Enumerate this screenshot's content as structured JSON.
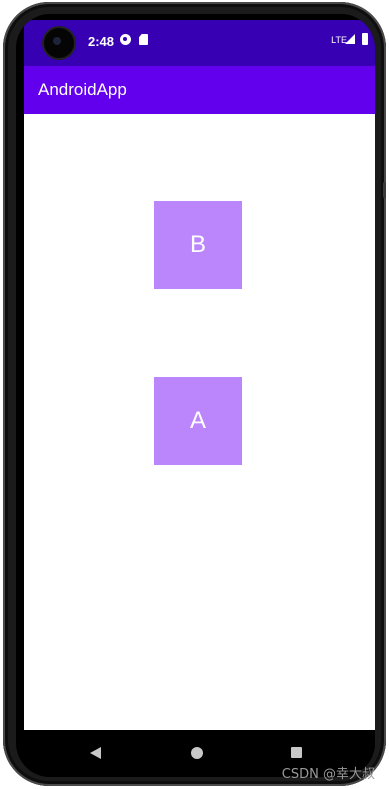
{
  "status_bar": {
    "time": "2:48",
    "network": "LTE",
    "background_color": "#3700b3",
    "icons": [
      "data-saver-icon",
      "sd-card-icon",
      "signal-icon",
      "battery-icon"
    ]
  },
  "app_bar": {
    "title": "AndroidApp",
    "background_color": "#6200ee"
  },
  "content": {
    "box_b_label": "B",
    "box_a_label": "A",
    "box_color": "#bb86fc"
  },
  "nav_bar": {
    "icons": [
      "back-icon",
      "home-icon",
      "recents-icon"
    ]
  },
  "watermark": "CSDN @幸大叔"
}
